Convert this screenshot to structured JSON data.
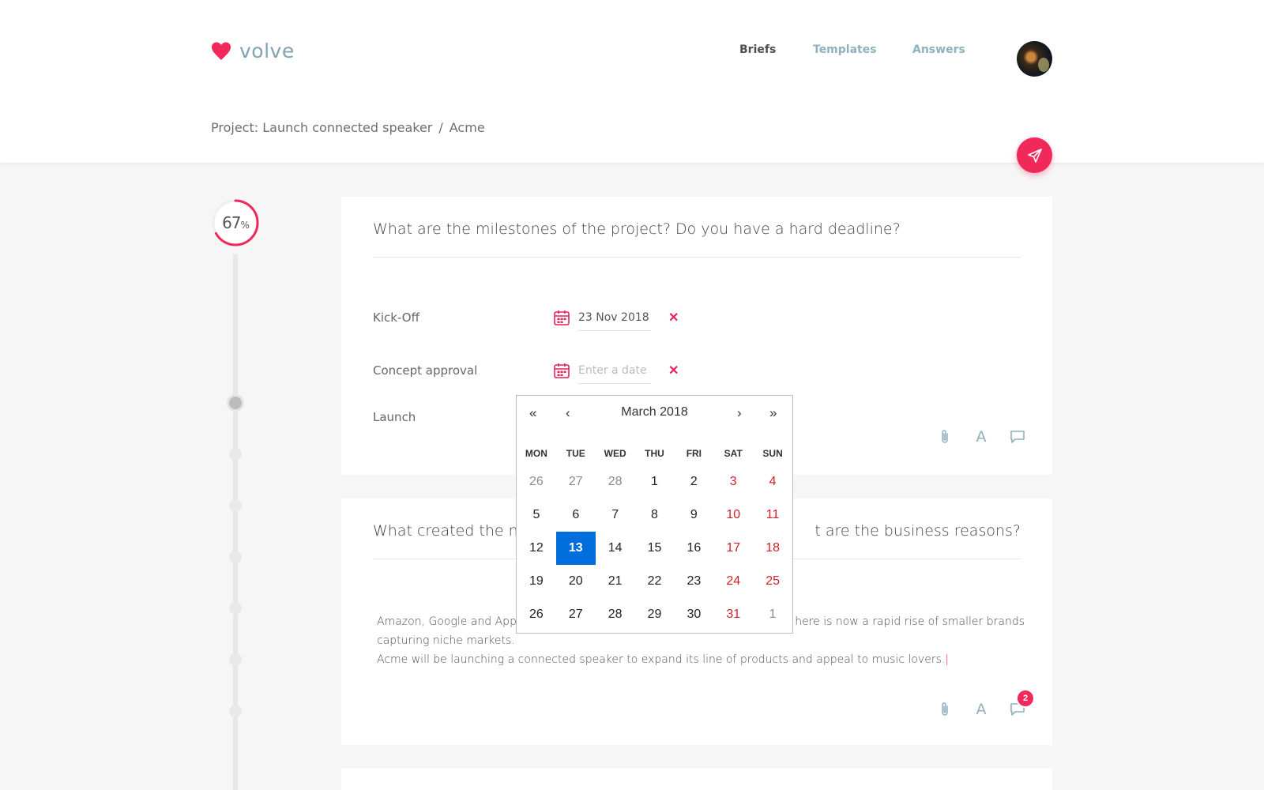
{
  "brand": {
    "name": "volve",
    "accent": "#f0295a",
    "nav_color": "#8fb0be"
  },
  "nav": [
    {
      "label": "Briefs",
      "active": true
    },
    {
      "label": "Templates",
      "active": false
    },
    {
      "label": "Answers",
      "active": false
    }
  ],
  "breadcrumb": {
    "project": "Project: Launch connected speaker",
    "separator": "/",
    "client": "Acme"
  },
  "progress": {
    "value": "67",
    "unit": "%",
    "fraction": 0.67
  },
  "questions": [
    {
      "title": "What are the milestones of the project? Do you have a hard deadline?",
      "milestones": [
        {
          "label": "Kick-Off",
          "value": "23 Nov 2018",
          "placeholder": ""
        },
        {
          "label": "Concept approval",
          "value": "",
          "placeholder": "Enter a date"
        },
        {
          "label": "Launch",
          "value": "",
          "placeholder": ""
        }
      ]
    },
    {
      "title_left": "What created the ne",
      "title_right": "t are the business reasons?",
      "answer_line1_left": "Amazon, Google and App",
      "answer_line1_right": "here is now a rapid rise of smaller brands",
      "answer_line2": "capturing niche markets.",
      "answer_line3": "Acme will be launching a connected speaker to expand its line of products and appeal to music lovers.",
      "caret": "|",
      "comment_count": "2"
    }
  ],
  "datepicker": {
    "prev_year": "«",
    "prev_month": "‹",
    "title": "March 2018",
    "next_month": "›",
    "next_year": "»",
    "weekdays": [
      "MON",
      "TUE",
      "WED",
      "THU",
      "FRI",
      "SAT",
      "SUN"
    ],
    "weeks": [
      [
        {
          "d": "26",
          "muted": true
        },
        {
          "d": "27",
          "muted": true
        },
        {
          "d": "28",
          "muted": true
        },
        {
          "d": "1"
        },
        {
          "d": "2"
        },
        {
          "d": "3",
          "weekend": true
        },
        {
          "d": "4",
          "weekend": true
        }
      ],
      [
        {
          "d": "5"
        },
        {
          "d": "6"
        },
        {
          "d": "7"
        },
        {
          "d": "8"
        },
        {
          "d": "9"
        },
        {
          "d": "10",
          "weekend": true
        },
        {
          "d": "11",
          "weekend": true
        }
      ],
      [
        {
          "d": "12"
        },
        {
          "d": "13",
          "selected": true
        },
        {
          "d": "14"
        },
        {
          "d": "15"
        },
        {
          "d": "16"
        },
        {
          "d": "17",
          "weekend": true
        },
        {
          "d": "18",
          "weekend": true
        }
      ],
      [
        {
          "d": "19"
        },
        {
          "d": "20"
        },
        {
          "d": "21"
        },
        {
          "d": "22"
        },
        {
          "d": "23"
        },
        {
          "d": "24",
          "weekend": true
        },
        {
          "d": "25",
          "weekend": true
        }
      ],
      [
        {
          "d": "26"
        },
        {
          "d": "27"
        },
        {
          "d": "28"
        },
        {
          "d": "29"
        },
        {
          "d": "30"
        },
        {
          "d": "31",
          "weekend": true
        },
        {
          "d": "1",
          "weekend": true,
          "muted": true
        }
      ]
    ]
  },
  "icons": {
    "attach": "paperclip-icon",
    "font": "text-format-icon",
    "comment": "comment-icon",
    "calendar": "calendar-icon",
    "send": "send-icon",
    "clear": "clear-icon"
  }
}
